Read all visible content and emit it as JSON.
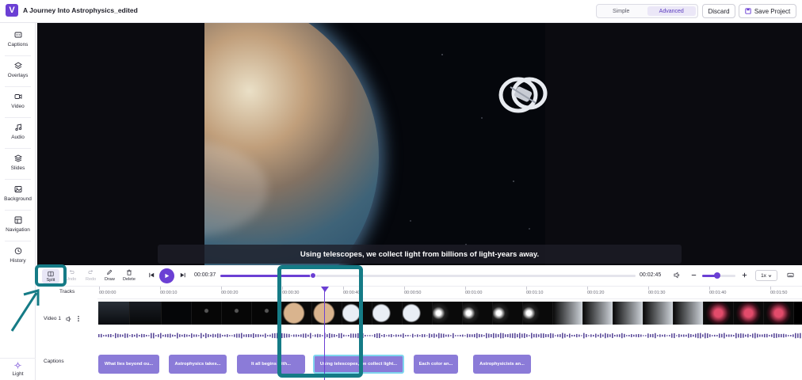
{
  "header": {
    "logo_letter": "V",
    "project_title": "A Journey Into Astrophysics_edited",
    "modes": [
      "Simple",
      "Advanced"
    ],
    "active_mode": "Advanced",
    "discard_label": "Discard",
    "save_label": "Save Project"
  },
  "sidebar": {
    "items": [
      {
        "label": "Captions",
        "icon": "captions-icon"
      },
      {
        "label": "Overlays",
        "icon": "layers-icon"
      },
      {
        "label": "Video",
        "icon": "video-camera-icon"
      },
      {
        "label": "Audio",
        "icon": "music-note-icon"
      },
      {
        "label": "Slides",
        "icon": "stack-icon"
      },
      {
        "label": "Background",
        "icon": "image-icon"
      },
      {
        "label": "Navigation",
        "icon": "layout-icon"
      },
      {
        "label": "History",
        "icon": "history-icon"
      }
    ],
    "light_label": "Light"
  },
  "preview": {
    "subtitle": "Using telescopes, we collect light from billions of light-years away."
  },
  "controls": {
    "split_label": "Split",
    "undo_label": "Undo",
    "redo_label": "Redo",
    "draw_label": "Draw",
    "delete_label": "Delete",
    "current_time": "00:00:37",
    "total_time": "00:02:45",
    "progress_fraction": 0.224,
    "zoom_fraction": 0.45,
    "speed": "1x"
  },
  "timeline": {
    "tracks_label": "Tracks",
    "ruler_ticks": [
      "00:00:00",
      "00:00:10",
      "00:00:20",
      "00:00:30",
      "00:00:40",
      "00:00:50",
      "00:01:00",
      "00:01:10",
      "00:01:20",
      "00:01:30",
      "00:01:40",
      "00:01:50"
    ],
    "video_track_label": "Video 1",
    "captions_track_label": "Captions",
    "captions": [
      {
        "text": "What lies beyond ou..."
      },
      {
        "text": "Astrophysics takes..."
      },
      {
        "text": "It all begins with..."
      },
      {
        "text": "Using telescopes, we collect light..."
      },
      {
        "text": "Each color an..."
      },
      {
        "text": "Astrophysicists an..."
      }
    ]
  },
  "colors": {
    "accent": "#6b3fd4",
    "caption_chip": "#8b7bd8",
    "annotation": "#157b86"
  }
}
